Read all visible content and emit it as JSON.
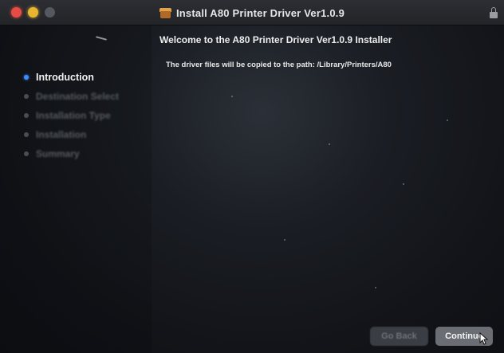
{
  "window": {
    "title": "Install A80 Printer Driver Ver1.0.9"
  },
  "sidebar": {
    "steps": [
      {
        "label": "Introduction",
        "active": true
      },
      {
        "label": "Destination Select",
        "active": false
      },
      {
        "label": "Installation Type",
        "active": false
      },
      {
        "label": "Installation",
        "active": false
      },
      {
        "label": "Summary",
        "active": false
      }
    ]
  },
  "content": {
    "heading": "Welcome to the A80 Printer Driver Ver1.0.9 Installer",
    "body": "The driver files will be copied to the path: /Library/Printers/A80"
  },
  "buttons": {
    "go_back": "Go Back",
    "continue": "Continue"
  },
  "colors": {
    "active_step_dot": "#3d8dff",
    "close": "#e64b44",
    "minimize": "#e8b52f"
  }
}
